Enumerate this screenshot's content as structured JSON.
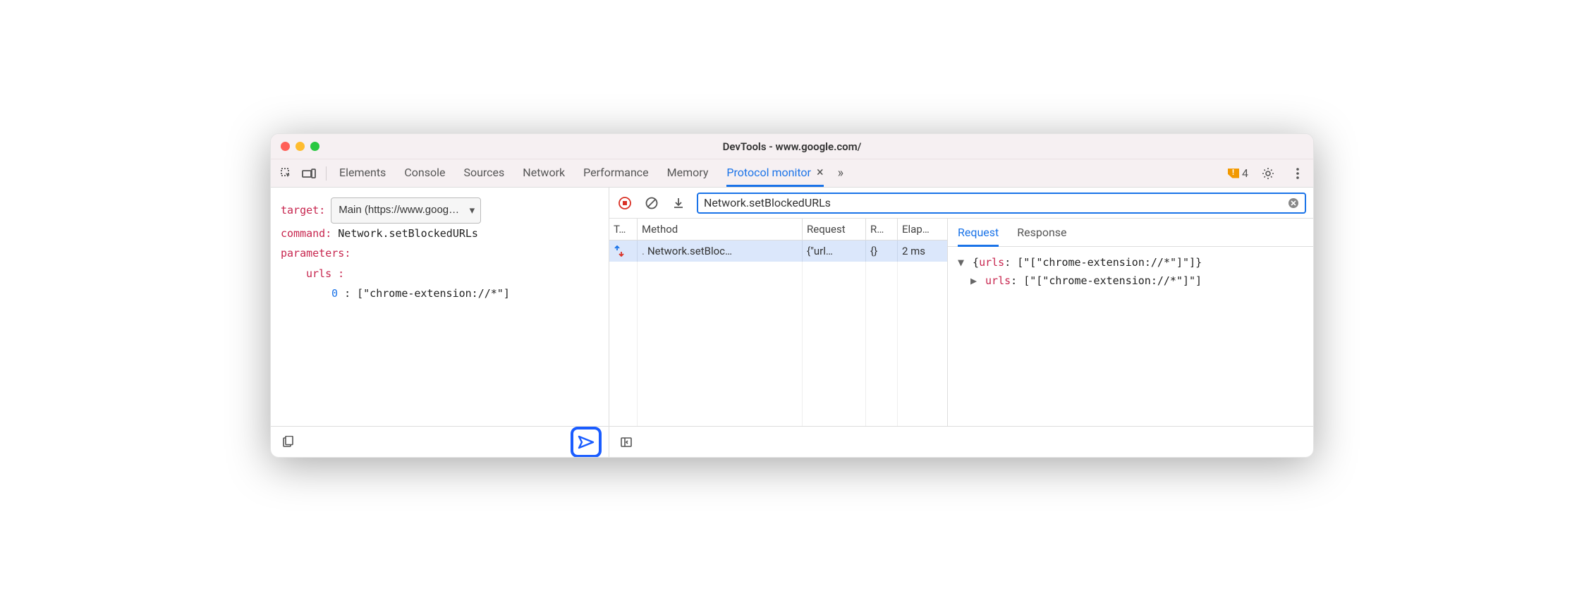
{
  "window": {
    "title": "DevTools - www.google.com/"
  },
  "tabs": {
    "items": [
      "Elements",
      "Console",
      "Sources",
      "Network",
      "Performance",
      "Memory",
      "Protocol monitor"
    ],
    "active": "Protocol monitor"
  },
  "warning_count": "4",
  "editor": {
    "target_label": "target",
    "target_value": "Main (https://www.goog…",
    "command_label": "command",
    "command_value": "Network.setBlockedURLs",
    "parameters_label": "parameters",
    "param_key": "urls",
    "param_index": "0",
    "param_value": "[\"chrome-extension://*\"]"
  },
  "search": {
    "value": "Network.setBlockedURLs"
  },
  "grid": {
    "headers": {
      "type": "T…",
      "method": "Method",
      "request": "Request",
      "response": "R…",
      "elapsed": "Elap…"
    },
    "row": {
      "method": "Network.setBloc…",
      "request": "{\"url…",
      "response": "{}",
      "elapsed": "2 ms"
    }
  },
  "details": {
    "tabs": [
      "Request",
      "Response"
    ],
    "active": "Request",
    "line1_key": "urls",
    "line1_val": "[\"[\"chrome-extension://*\"]\"]",
    "line2_key": "urls",
    "line2_val": "[\"[\"chrome-extension://*\"]\"]"
  }
}
